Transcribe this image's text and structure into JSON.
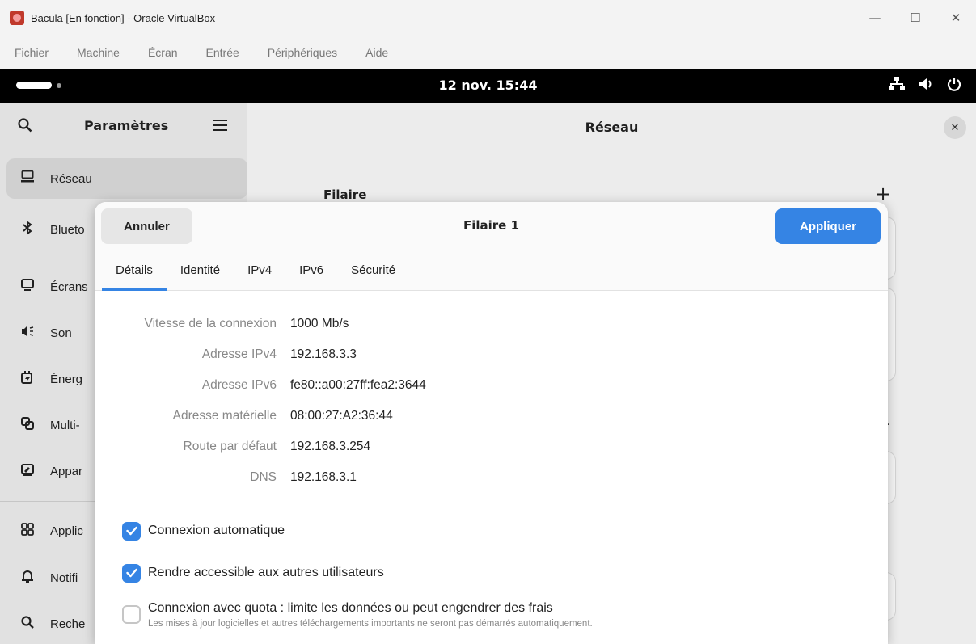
{
  "window": {
    "title": "Bacula [En fonction] - Oracle VirtualBox",
    "minimize": "—",
    "maximize": "☐",
    "close": "✕"
  },
  "menubar": [
    "Fichier",
    "Machine",
    "Écran",
    "Entrée",
    "Périphériques",
    "Aide"
  ],
  "topbar": {
    "clock": "12 nov. 15:44"
  },
  "sidebar": {
    "title": "Paramètres",
    "items": [
      {
        "label": "Réseau",
        "icon": "network-icon"
      },
      {
        "label": "Blueto",
        "icon": "bluetooth-icon"
      },
      {
        "label": "Écrans",
        "icon": "display-icon"
      },
      {
        "label": "Son",
        "icon": "sound-icon"
      },
      {
        "label": "Énerg",
        "icon": "power-icon"
      },
      {
        "label": "Multi-",
        "icon": "multitasking-icon"
      },
      {
        "label": "Appar",
        "icon": "appearance-icon"
      },
      {
        "label": "Applic",
        "icon": "apps-icon"
      },
      {
        "label": "Notifi",
        "icon": "bell-icon"
      },
      {
        "label": "Reche",
        "icon": "search-icon"
      }
    ]
  },
  "content": {
    "title": "Réseau",
    "section": "Filaire"
  },
  "dialog": {
    "title": "Filaire 1",
    "cancel_label": "Annuler",
    "apply_label": "Appliquer",
    "tabs": [
      "Détails",
      "Identité",
      "IPv4",
      "IPv6",
      "Sécurité"
    ],
    "active_tab": "Détails",
    "details": [
      {
        "key": "Vitesse de la connexion",
        "value": "1000 Mb/s"
      },
      {
        "key": "Adresse IPv4",
        "value": "192.168.3.3"
      },
      {
        "key": "Adresse IPv6",
        "value": "fe80::a00:27ff:fea2:3644"
      },
      {
        "key": "Adresse matérielle",
        "value": "08:00:27:A2:36:44"
      },
      {
        "key": "Route par défaut",
        "value": "192.168.3.254"
      },
      {
        "key": "DNS",
        "value": "192.168.3.1"
      }
    ],
    "auto_connect": {
      "label": "Connexion automatique",
      "checked": true
    },
    "share_users": {
      "label": "Rendre accessible aux autres utilisateurs",
      "checked": true
    },
    "metered": {
      "label": "Connexion avec quota : limite les données ou peut engendrer des frais",
      "sublabel": "Les mises à jour logicielles et autres téléchargements importants ne seront pas démarrés automatiquement.",
      "checked": false
    }
  },
  "colors": {
    "accent": "#3584e4",
    "topbar": "#000000",
    "sidebar": "#ebebeb"
  }
}
